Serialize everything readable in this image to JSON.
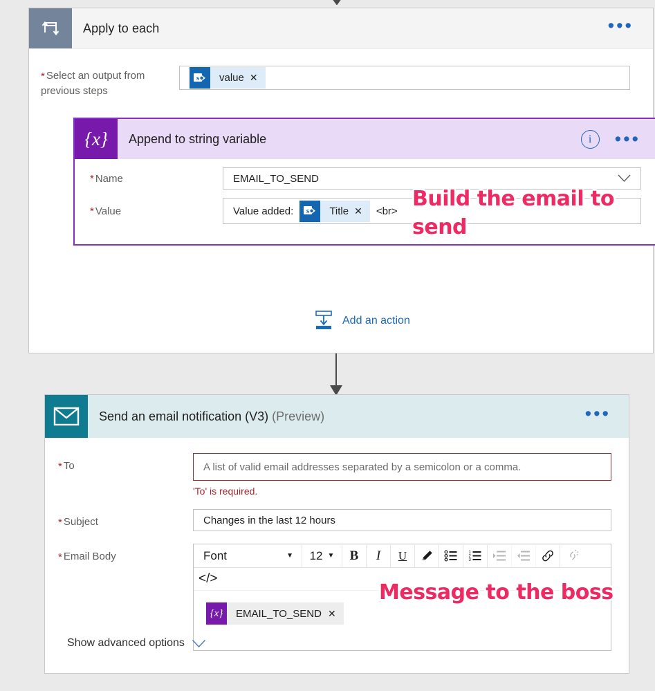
{
  "page": {
    "background_color": "#eaeaea"
  },
  "apply_to_each": {
    "title": "Apply to each",
    "icon": "loop-icon",
    "header_color": "#74859b",
    "more_label": "•••",
    "select_output": {
      "label": "Select an output from previous steps",
      "required_marker": "*",
      "token": {
        "icon": "sharepoint-icon",
        "label": "value",
        "remove": "✕"
      }
    },
    "add_action": {
      "label": "Add an action",
      "icon": "add-action-icon",
      "color": "#1a6bb8"
    }
  },
  "append_variable": {
    "title": "Append to string variable",
    "icon": "variable-braces-icon",
    "icon_glyph": "{x}",
    "header_color": "#7719aa",
    "border_color": "#8031c4",
    "info_label": "i",
    "more_label": "•••",
    "fields": [
      {
        "label": "Name",
        "required_marker": "*",
        "value": "EMAIL_TO_SEND",
        "chevron": "chevron-down-icon"
      },
      {
        "label": "Value",
        "required_marker": "*",
        "prefix_text": "Value added:",
        "token": {
          "icon": "sharepoint-icon",
          "label": "Title",
          "remove": "✕"
        },
        "suffix_text": "<br>"
      }
    ]
  },
  "send_email": {
    "title": "Send an email notification (V3)",
    "preview_suffix": "(Preview)",
    "icon": "envelope-icon",
    "header_color": "#0f7b91",
    "more_label": "•••",
    "to": {
      "label": "To",
      "required_marker": "*",
      "placeholder": "A list of valid email addresses separated by a semicolon or a comma.",
      "value": "",
      "error": "'To' is required.",
      "error_color": "#a4262c"
    },
    "subject": {
      "label": "Subject",
      "required_marker": "*",
      "value": "Changes in the last 12 hours"
    },
    "email_body": {
      "label": "Email Body",
      "required_marker": "*",
      "toolbar": {
        "font_label": "Font",
        "font_caret": "▼",
        "size_label": "12",
        "size_caret": "▼",
        "bold": "B",
        "italic": "I",
        "underline": "U",
        "highlighter": "highlighter-icon",
        "bulleted_list": "bulleted-list-icon",
        "numbered_list": "numbered-list-icon",
        "indent": "indent-icon",
        "outdent": "outdent-icon",
        "link": "link-icon",
        "unlink": "unlink-icon",
        "code_view": "</>"
      },
      "token": {
        "icon": "variable-braces-icon",
        "icon_glyph": "{x}",
        "label": "EMAIL_TO_SEND",
        "remove": "✕"
      }
    },
    "show_advanced": {
      "label": "Show advanced options",
      "chevron": "chevron-down-icon"
    }
  },
  "annotations": [
    {
      "id": "build-email",
      "text": "Build the email to send",
      "color": "#ee2a63"
    },
    {
      "id": "message-to-boss",
      "text": "Message to the boss",
      "color": "#ee2a63"
    }
  ]
}
